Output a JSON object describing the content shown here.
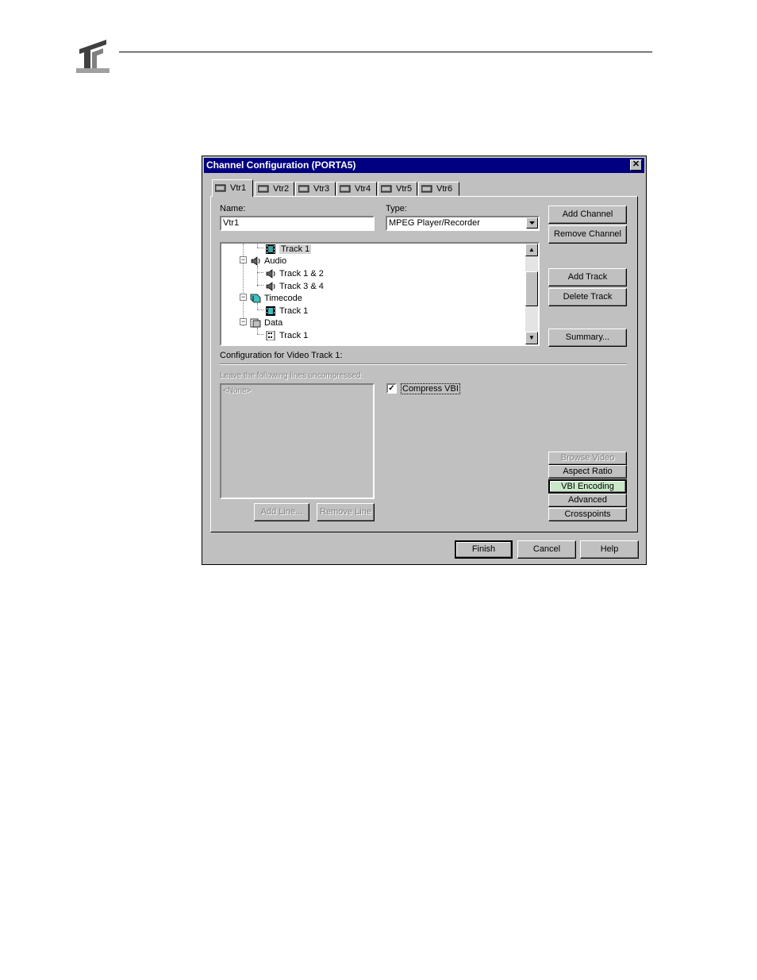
{
  "page": {
    "logo": "pinnacle-logo"
  },
  "dialog": {
    "title": "Channel Configuration (PORTA5)",
    "close_glyph": "✕",
    "tabs": [
      {
        "label": "Vtr1",
        "icon": "vtr-icon",
        "active": true
      },
      {
        "label": "Vtr2",
        "icon": "vtr-icon"
      },
      {
        "label": "Vtr3",
        "icon": "vtr-icon"
      },
      {
        "label": "Vtr4",
        "icon": "vtr-icon"
      },
      {
        "label": "Vtr5",
        "icon": "vtr-icon"
      },
      {
        "label": "Vtr6",
        "icon": "vtr-icon"
      }
    ],
    "name_label": "Name:",
    "name_value": "Vtr1",
    "type_label": "Type:",
    "type_value": "MPEG Player/Recorder",
    "buttons": {
      "add_channel": "Add Channel",
      "remove_channel": "Remove Channel",
      "add_track": "Add Track",
      "delete_track": "Delete Track",
      "summary": "Summary...",
      "browse_video": "Browse Video",
      "aspect_ratio": "Aspect Ratio",
      "vbi_encoding": "VBI Encoding",
      "advanced": "Advanced",
      "crosspoints": "Crosspoints",
      "add_line": "Add Line...",
      "remove_line": "Remove Line",
      "finish": "Finish",
      "cancel": "Cancel",
      "help": "Help"
    },
    "tree": [
      {
        "label": "Track 1",
        "icon": "film-icon",
        "selected": true
      },
      {
        "label": "Audio",
        "icon": "speaker-icon"
      },
      {
        "label": "Track 1 & 2",
        "icon": "speaker-icon"
      },
      {
        "label": "Track 3 & 4",
        "icon": "speaker-icon"
      },
      {
        "label": "Timecode",
        "icon": "timecode-icon"
      },
      {
        "label": "Track 1",
        "icon": "timecode-track-icon"
      },
      {
        "label": "Data",
        "icon": "data-icon"
      },
      {
        "label": "Track 1",
        "icon": "data-track-icon"
      }
    ],
    "config_label": "Configuration for Video Track 1:",
    "uncompressed_label": "Leave the following lines uncompressed:",
    "uncompressed_list": [
      "<None>"
    ],
    "compress_vbi_label": "Compress VBI",
    "compress_vbi_checked": true
  }
}
